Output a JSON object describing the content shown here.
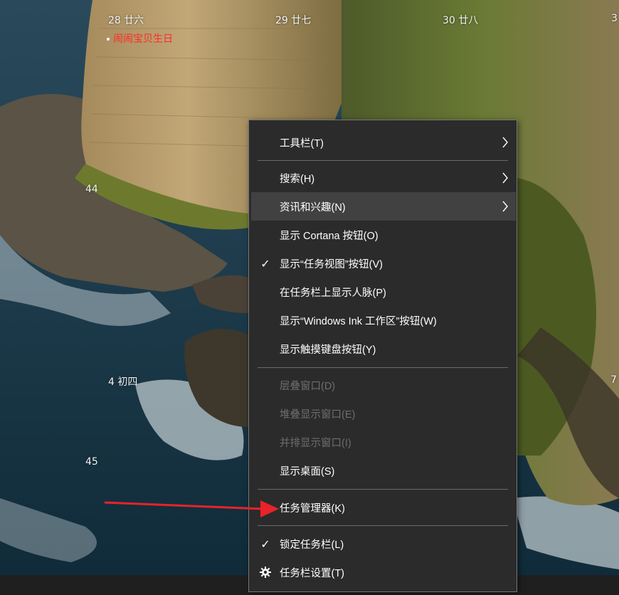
{
  "calendar": {
    "day1": "28 廿六",
    "event1": "闹闹宝贝生日",
    "day2": "29 廿七",
    "day3": "30 廿八",
    "day4_partial": "3",
    "week44": "44",
    "day5": "4 初四",
    "week45": "45",
    "edge_partial": "7"
  },
  "context_menu": {
    "items": [
      {
        "label": "工具栏(T)",
        "state": "normal",
        "submenu": true
      },
      {
        "label": "搜索(H)",
        "state": "normal",
        "submenu": true
      },
      {
        "label": "资讯和兴趣(N)",
        "state": "hover",
        "submenu": true
      },
      {
        "label": "显示 Cortana 按钮(O)",
        "state": "normal"
      },
      {
        "label": "显示“任务视图”按钮(V)",
        "state": "checked"
      },
      {
        "label": "在任务栏上显示人脉(P)",
        "state": "normal"
      },
      {
        "label": "显示“Windows Ink 工作区”按钮(W)",
        "state": "normal"
      },
      {
        "label": "显示触摸键盘按钮(Y)",
        "state": "normal"
      },
      {
        "label": "层叠窗口(D)",
        "state": "disabled"
      },
      {
        "label": "堆叠显示窗口(E)",
        "state": "disabled"
      },
      {
        "label": "并排显示窗口(I)",
        "state": "disabled"
      },
      {
        "label": "显示桌面(S)",
        "state": "normal"
      },
      {
        "label": "任务管理器(K)",
        "state": "normal",
        "annotated": true
      },
      {
        "label": "锁定任务栏(L)",
        "state": "checked"
      },
      {
        "label": "任务栏设置(T)",
        "state": "normal",
        "icon": "gear-icon"
      }
    ],
    "check_glyph": "✓"
  },
  "colors": {
    "menu_bg": "#2b2b2b",
    "menu_hover": "#414141",
    "disabled_text": "#6e6e6e",
    "event_text": "#ff2a2a",
    "annotation_arrow": "#e8232a"
  }
}
